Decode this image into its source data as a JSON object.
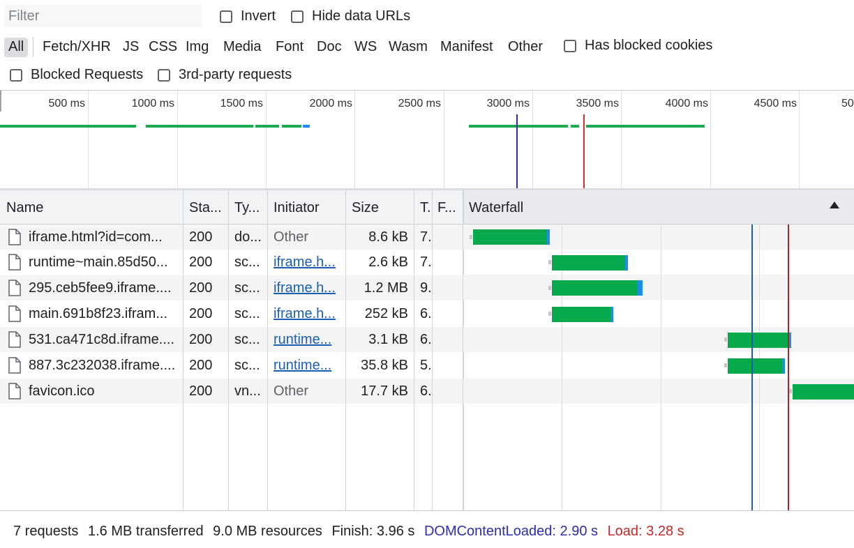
{
  "toolbar": {
    "filter_placeholder": "Filter",
    "invert_label": "Invert",
    "hide_data_urls_label": "Hide data URLs",
    "types": [
      "All",
      "Fetch/XHR",
      "JS",
      "CSS",
      "Img",
      "Media",
      "Font",
      "Doc",
      "WS",
      "Wasm",
      "Manifest",
      "Other"
    ],
    "active_type": "All",
    "has_blocked_cookies_label": "Has blocked cookies",
    "blocked_requests_label": "Blocked Requests",
    "third_party_label": "3rd-party requests"
  },
  "overview": {
    "ticks": [
      "500 ms",
      "1000 ms",
      "1500 ms",
      "2000 ms",
      "2500 ms",
      "3000 ms",
      "3500 ms",
      "4000 ms",
      "4500 ms",
      "50"
    ],
    "dcl_color": "#2d2d9b",
    "load_color": "#d32f2f"
  },
  "columns": {
    "name": "Name",
    "status": "Sta...",
    "type": "Ty...",
    "initiator": "Initiator",
    "size": "Size",
    "time": "T.",
    "fulfilled": "F...",
    "waterfall": "Waterfall"
  },
  "requests": [
    {
      "name": "iframe.html?id=com...",
      "status": "200",
      "type": "do...",
      "initiator": "Other",
      "initiator_link": false,
      "size": "8.6 kB",
      "time": "7."
    },
    {
      "name": "runtime~main.85d50...",
      "status": "200",
      "type": "sc...",
      "initiator": "iframe.h...",
      "initiator_link": true,
      "size": "2.6 kB",
      "time": "7."
    },
    {
      "name": "295.ceb5fee9.iframe....",
      "status": "200",
      "type": "sc...",
      "initiator": "iframe.h...",
      "initiator_link": true,
      "size": "1.2 MB",
      "time": "9."
    },
    {
      "name": "main.691b8f23.ifram...",
      "status": "200",
      "type": "sc...",
      "initiator": "iframe.h...",
      "initiator_link": true,
      "size": "252 kB",
      "time": "6."
    },
    {
      "name": "531.ca471c8d.iframe....",
      "status": "200",
      "type": "sc...",
      "initiator": "runtime...",
      "initiator_link": true,
      "size": "3.1 kB",
      "time": "6."
    },
    {
      "name": "887.3c232038.iframe....",
      "status": "200",
      "type": "sc...",
      "initiator": "runtime...",
      "initiator_link": true,
      "size": "35.8 kB",
      "time": "5."
    },
    {
      "name": "favicon.ico",
      "status": "200",
      "type": "vn...",
      "initiator": "Other",
      "initiator_link": false,
      "size": "17.7 kB",
      "time": "6."
    }
  ],
  "status_bar": {
    "requests": "7 requests",
    "transferred": "1.6 MB transferred",
    "resources": "9.0 MB resources",
    "finish": "Finish: 3.96 s",
    "dcl": "DOMContentLoaded: 2.90 s",
    "load": "Load: 3.28 s",
    "dcl_color": "#2d2db0",
    "load_color": "#c62828"
  }
}
